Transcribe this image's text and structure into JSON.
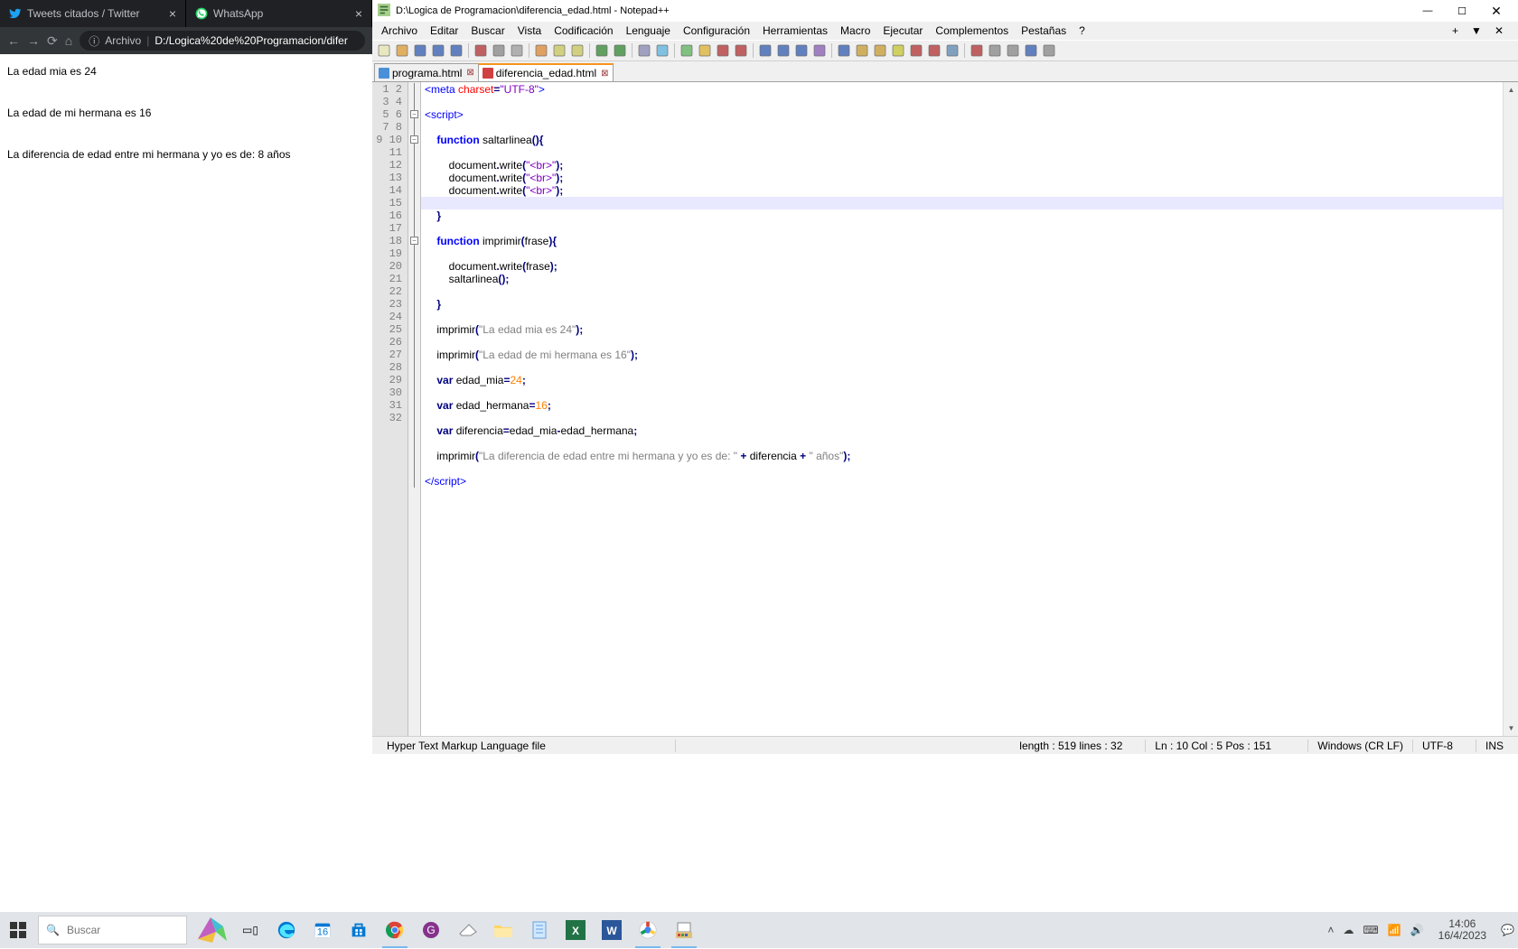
{
  "browser": {
    "tabs": [
      {
        "label": "Tweets citados / Twitter",
        "icon": "twitter",
        "active": false
      },
      {
        "label": "WhatsApp",
        "icon": "whatsapp",
        "active": false
      }
    ],
    "url_prefix": "Archivo",
    "url_path": "D:/Logica%20de%20Programacion/difer",
    "page_lines": [
      "La edad mia es 24",
      "La edad de mi hermana es 16",
      "La diferencia de edad entre mi hermana y yo es de: 8 años"
    ]
  },
  "npp": {
    "title": "D:\\Logica de Programacion\\diferencia_edad.html - Notepad++",
    "menus": [
      "Archivo",
      "Editar",
      "Buscar",
      "Vista",
      "Codificación",
      "Lenguaje",
      "Configuración",
      "Herramientas",
      "Macro",
      "Ejecutar",
      "Complementos",
      "Pestañas",
      "?"
    ],
    "file_tabs": [
      {
        "label": "programa.html",
        "active": false
      },
      {
        "label": "diferencia_edad.html",
        "active": true
      }
    ],
    "code_tokens": [
      [
        [
          "tag",
          "<meta"
        ],
        [
          "",
          " "
        ],
        [
          "attr",
          "charset"
        ],
        [
          "op",
          "="
        ],
        [
          "str",
          "\"UTF-8\""
        ],
        [
          "tag",
          ">"
        ]
      ],
      [],
      [
        [
          "tag",
          "<script>"
        ]
      ],
      [],
      [
        [
          "",
          "    "
        ],
        [
          "kw",
          "function"
        ],
        [
          "",
          " "
        ],
        [
          "id",
          "saltarlinea"
        ],
        [
          "op",
          "()"
        ],
        [
          "op",
          "{"
        ]
      ],
      [],
      [
        [
          "",
          "        "
        ],
        [
          "id",
          "document"
        ],
        [
          "op",
          "."
        ],
        [
          "id",
          "write"
        ],
        [
          "op",
          "("
        ],
        [
          "str",
          "\"<br>\""
        ],
        [
          "op",
          ")"
        ],
        [
          "op",
          ";"
        ]
      ],
      [
        [
          "",
          "        "
        ],
        [
          "id",
          "document"
        ],
        [
          "op",
          "."
        ],
        [
          "id",
          "write"
        ],
        [
          "op",
          "("
        ],
        [
          "str",
          "\"<br>\""
        ],
        [
          "op",
          ")"
        ],
        [
          "op",
          ";"
        ]
      ],
      [
        [
          "",
          "        "
        ],
        [
          "id",
          "document"
        ],
        [
          "op",
          "."
        ],
        [
          "id",
          "write"
        ],
        [
          "op",
          "("
        ],
        [
          "str",
          "\"<br>\""
        ],
        [
          "op",
          ")"
        ],
        [
          "op",
          ";"
        ]
      ],
      [],
      [
        [
          "",
          "    "
        ],
        [
          "op",
          "}"
        ]
      ],
      [],
      [
        [
          "",
          "    "
        ],
        [
          "kw",
          "function"
        ],
        [
          "",
          " "
        ],
        [
          "id",
          "imprimir"
        ],
        [
          "op",
          "("
        ],
        [
          "id",
          "frase"
        ],
        [
          "op",
          ")"
        ],
        [
          "op",
          "{"
        ]
      ],
      [],
      [
        [
          "",
          "        "
        ],
        [
          "id",
          "document"
        ],
        [
          "op",
          "."
        ],
        [
          "id",
          "write"
        ],
        [
          "op",
          "("
        ],
        [
          "id",
          "frase"
        ],
        [
          "op",
          ")"
        ],
        [
          "op",
          ";"
        ]
      ],
      [
        [
          "",
          "        "
        ],
        [
          "id",
          "saltarlinea"
        ],
        [
          "op",
          "()"
        ],
        [
          "op",
          ";"
        ]
      ],
      [],
      [
        [
          "",
          "    "
        ],
        [
          "op",
          "}"
        ]
      ],
      [],
      [
        [
          "",
          "    "
        ],
        [
          "id",
          "imprimir"
        ],
        [
          "op",
          "("
        ],
        [
          "lit",
          "\"La edad mia es 24\""
        ],
        [
          "op",
          ")"
        ],
        [
          "op",
          ";"
        ]
      ],
      [],
      [
        [
          "",
          "    "
        ],
        [
          "id",
          "imprimir"
        ],
        [
          "op",
          "("
        ],
        [
          "lit",
          "\"La edad de mi hermana es 16\""
        ],
        [
          "op",
          ")"
        ],
        [
          "op",
          ";"
        ]
      ],
      [],
      [
        [
          "",
          "    "
        ],
        [
          "kw2",
          "var"
        ],
        [
          "",
          " "
        ],
        [
          "id",
          "edad_mia"
        ],
        [
          "op",
          "="
        ],
        [
          "num",
          "24"
        ],
        [
          "op",
          ";"
        ]
      ],
      [],
      [
        [
          "",
          "    "
        ],
        [
          "kw2",
          "var"
        ],
        [
          "",
          " "
        ],
        [
          "id",
          "edad_hermana"
        ],
        [
          "op",
          "="
        ],
        [
          "num",
          "16"
        ],
        [
          "op",
          ";"
        ]
      ],
      [],
      [
        [
          "",
          "    "
        ],
        [
          "kw2",
          "var"
        ],
        [
          "",
          " "
        ],
        [
          "id",
          "diferencia"
        ],
        [
          "op",
          "="
        ],
        [
          "id",
          "edad_mia"
        ],
        [
          "op",
          "-"
        ],
        [
          "id",
          "edad_hermana"
        ],
        [
          "op",
          ";"
        ]
      ],
      [],
      [
        [
          "",
          "    "
        ],
        [
          "id",
          "imprimir"
        ],
        [
          "op",
          "("
        ],
        [
          "lit",
          "\"La diferencia de edad entre mi hermana y yo es de: \""
        ],
        [
          "",
          " "
        ],
        [
          "op",
          "+"
        ],
        [
          "",
          " "
        ],
        [
          "id",
          "diferencia"
        ],
        [
          "",
          " "
        ],
        [
          "op",
          "+"
        ],
        [
          "",
          " "
        ],
        [
          "lit",
          "\" años\""
        ],
        [
          "op",
          ")"
        ],
        [
          "op",
          ";"
        ]
      ],
      [],
      [
        [
          "tag",
          "</"
        ],
        [
          "tag",
          "script"
        ],
        [
          "tag",
          ">"
        ]
      ]
    ],
    "total_lines": 32,
    "current_line": 10,
    "fold_minus_at": [
      3,
      5,
      13
    ],
    "status": {
      "filetype": "Hyper Text Markup Language file",
      "length": "length : 519    lines : 32",
      "pos": "Ln : 10    Col : 5    Pos : 151",
      "eol": "Windows (CR LF)",
      "enc": "UTF-8",
      "ins": "INS"
    }
  },
  "taskbar": {
    "search_placeholder": "Buscar",
    "clock_time": "14:06",
    "clock_date": "16/4/2023"
  }
}
